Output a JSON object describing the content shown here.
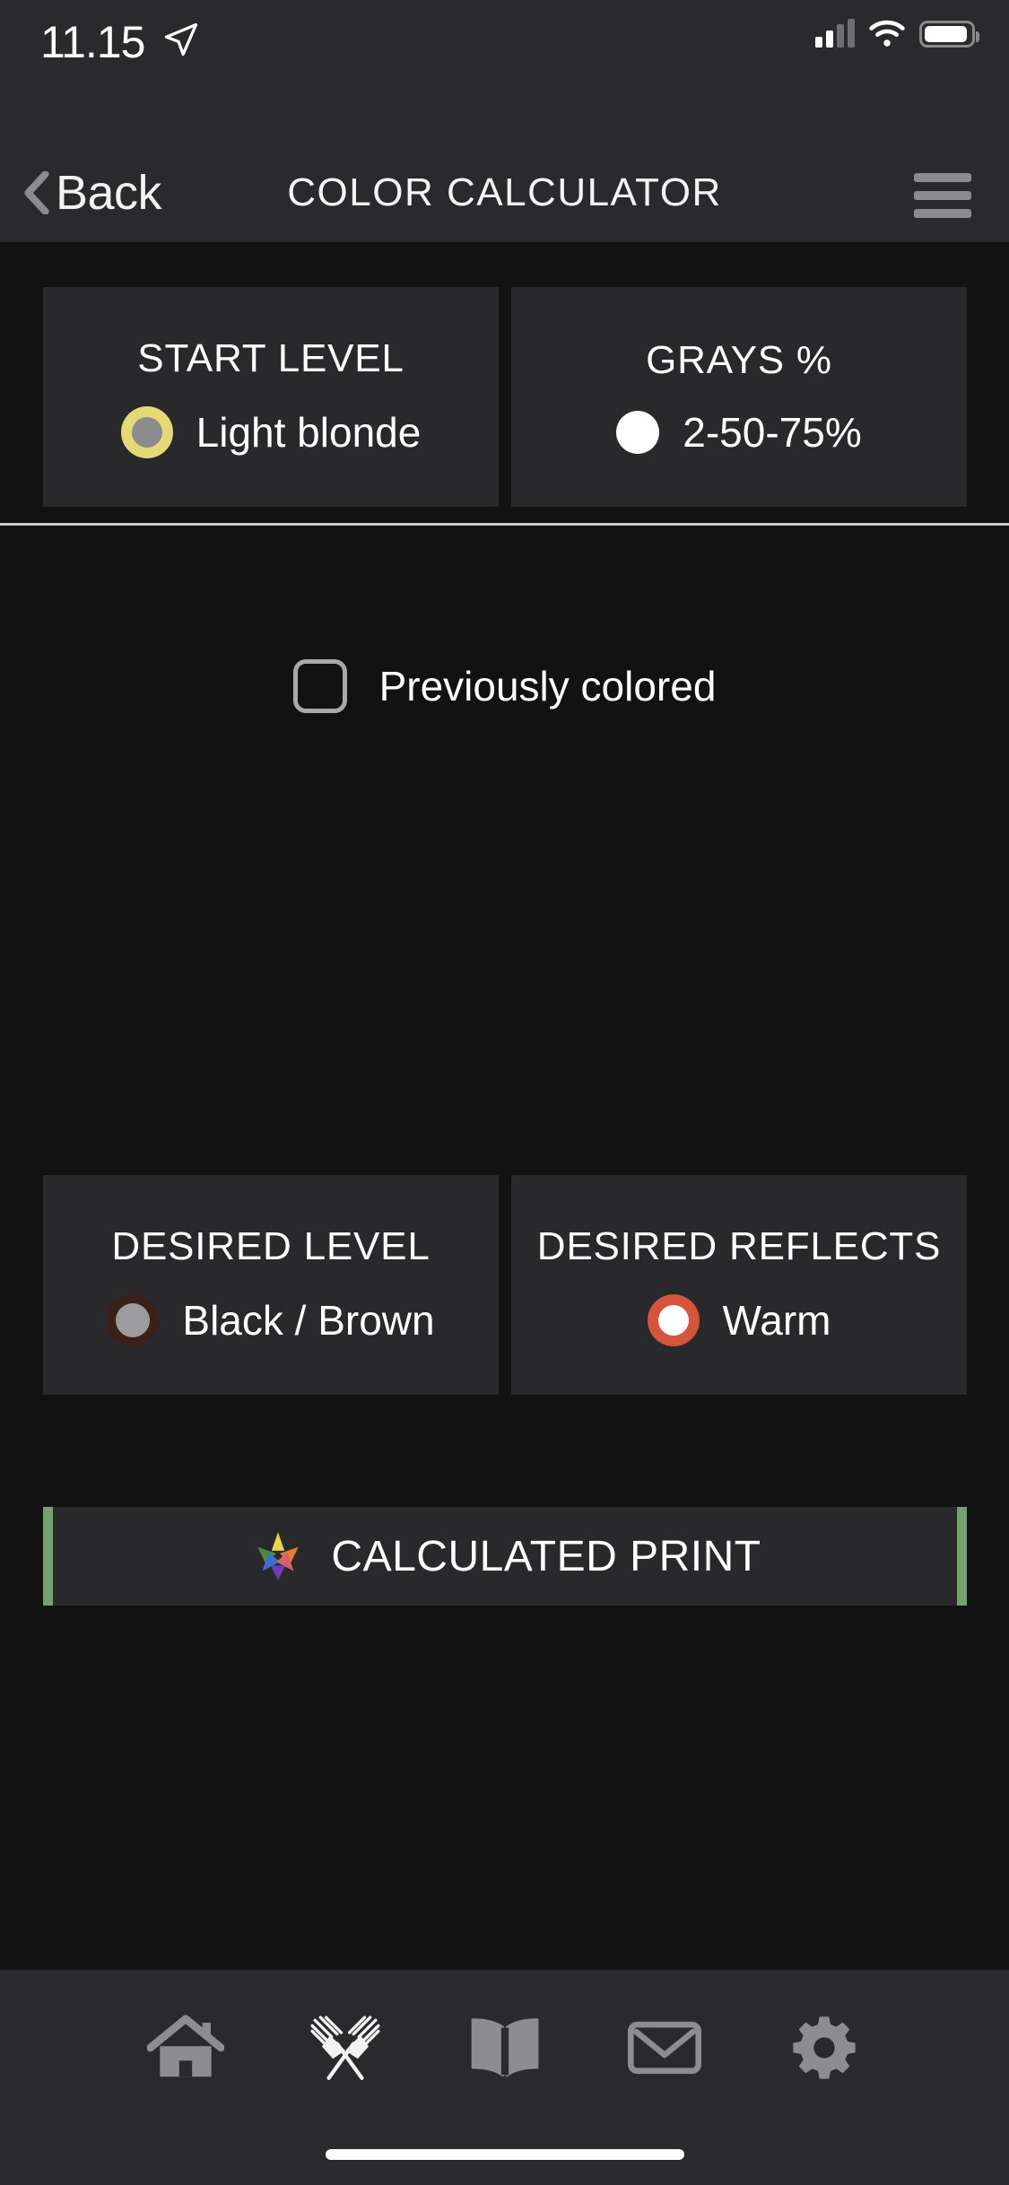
{
  "status_bar": {
    "time": "11.15",
    "location_icon": "location-arrow-icon",
    "signal_icon": "cellular-signal-icon",
    "wifi_icon": "wifi-icon",
    "battery_icon": "battery-icon"
  },
  "nav": {
    "back_label": "Back",
    "back_icon": "chevron-left-icon",
    "title": "COLOR CALCULATOR",
    "menu_icon": "hamburger-menu-icon"
  },
  "start_section": {
    "cards": [
      {
        "title": "START LEVEL",
        "value": "Light blonde",
        "swatch_kind": "ring-yellow",
        "swatch_outer_color": "#e4d977",
        "swatch_inner_color": "#8c8c8f"
      },
      {
        "title": "GRAYS %",
        "value": "2-50-75%",
        "swatch_kind": "plain-white",
        "swatch_outer_color": "#ffffff",
        "swatch_inner_color": "#ffffff"
      }
    ],
    "checkbox": {
      "label": "Previously colored",
      "checked": "false"
    }
  },
  "desired_section": {
    "cards": [
      {
        "title": "DESIRED LEVEL",
        "value": "Black / Brown",
        "swatch_kind": "ring-brown",
        "swatch_outer_color": "#3a2118",
        "swatch_inner_color": "#9c9c9e"
      },
      {
        "title": "DESIRED REFLECTS",
        "value": "Warm",
        "swatch_kind": "ring-orange",
        "swatch_outer_color": "#d4553c",
        "swatch_inner_color": "#ffffff"
      }
    ]
  },
  "calculate_button": {
    "label": "CALCULATED PRINT",
    "icon": "color-star-icon",
    "edge_color": "#75a06f"
  },
  "tabbar": {
    "items": [
      {
        "icon": "home-icon"
      },
      {
        "icon": "crossed-color-brushes-icon"
      },
      {
        "icon": "open-book-icon"
      },
      {
        "icon": "mail-envelope-icon"
      },
      {
        "icon": "gear-icon"
      }
    ]
  },
  "colors": {
    "screen_bg": "#121213",
    "bar_bg": "#2a2a2c",
    "card_bg": "#29292b",
    "accent_green": "#75a06f",
    "accent_orange": "#d4553c",
    "divider": "#c9c9cc"
  }
}
